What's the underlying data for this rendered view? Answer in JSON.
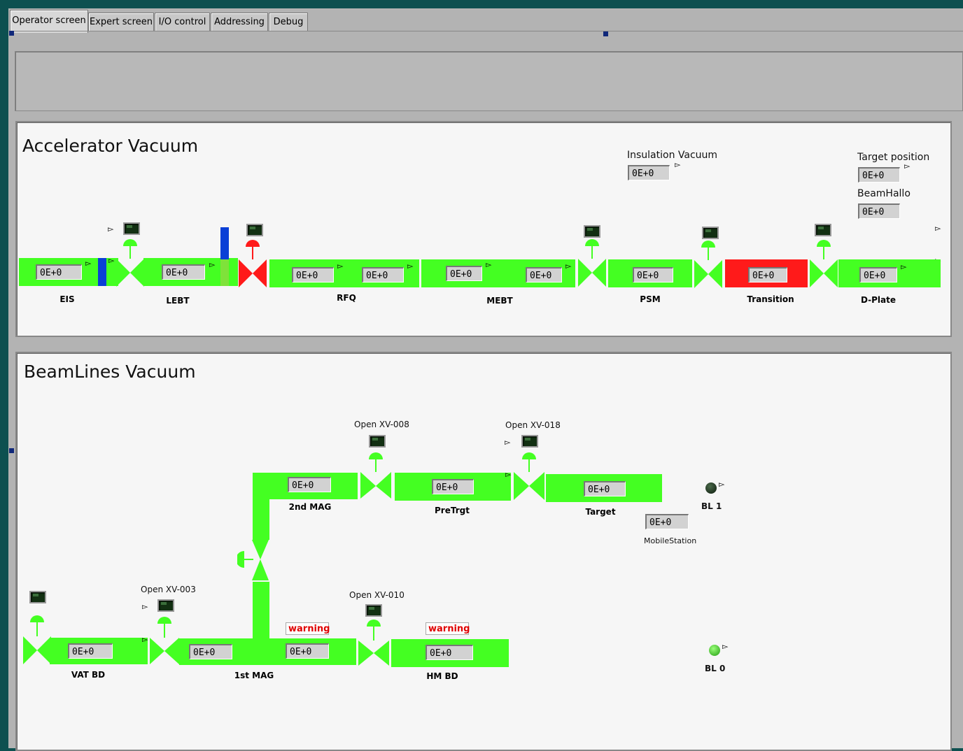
{
  "tabs": [
    "Operator screen",
    "Expert screen",
    "I/O control",
    "Addressing",
    "Debug"
  ],
  "accelerator": {
    "title": "Accelerator Vacuum",
    "insulation_label": "Insulation Vacuum",
    "insulation_value": "0E+0",
    "target_position_label": "Target position",
    "target_position_value": "0E+0",
    "beamhallo_label": "BeamHallo",
    "beamhallo_value": "0E+0",
    "segments": [
      {
        "label": "EIS",
        "values": [
          "0E+0"
        ]
      },
      {
        "label": "LEBT",
        "values": [
          "0E+0"
        ]
      },
      {
        "label": "RFQ",
        "values": [
          "0E+0",
          "0E+0"
        ]
      },
      {
        "label": "MEBT",
        "values": [
          "0E+0",
          "0E+0"
        ]
      },
      {
        "label": "PSM",
        "values": [
          "0E+0"
        ]
      },
      {
        "label": "Transition",
        "values": [
          "0E+0"
        ]
      },
      {
        "label": "D-Plate",
        "values": [
          "0E+0"
        ]
      }
    ]
  },
  "beamlines": {
    "title": "BeamLines Vacuum",
    "valve_labels": [
      "Open XV-008",
      "Open XV-018",
      "Open XV-003",
      "Open XV-010"
    ],
    "segments": [
      {
        "label": "2nd MAG",
        "values": [
          "0E+0"
        ]
      },
      {
        "label": "PreTrgt",
        "values": [
          "0E+0"
        ]
      },
      {
        "label": "Target",
        "values": [
          "0E+0"
        ]
      },
      {
        "label": "VAT BD",
        "values": [
          "0E+0"
        ]
      },
      {
        "label": "1st MAG",
        "values": [
          "0E+0",
          "0E+0"
        ]
      },
      {
        "label": "HM BD",
        "values": [
          "0E+0"
        ]
      }
    ],
    "warning_text": "warning",
    "mobile_station_label": "MobileStation",
    "mobile_station_value": "0E+0",
    "bl1_label": "BL 1",
    "bl0_label": "BL 0"
  },
  "colors": {
    "pipe": "#44ff22",
    "alarm": "#ff1a1a",
    "valve_closed": "#ff1a1a",
    "bar": "#0a3fd6"
  }
}
